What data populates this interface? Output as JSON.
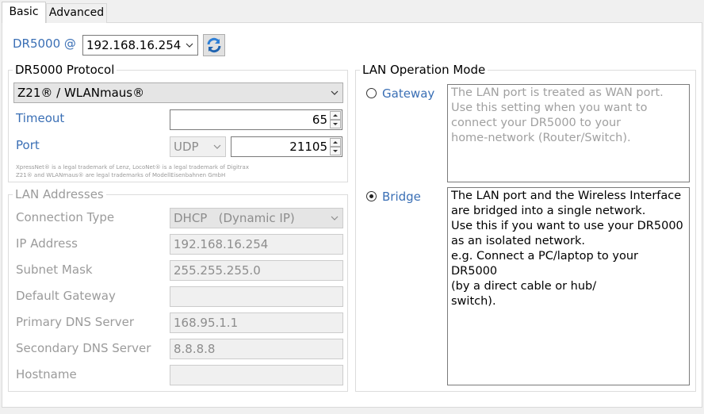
{
  "tabs": [
    {
      "label": "Basic"
    },
    {
      "label": "Advanced"
    }
  ],
  "device": {
    "label": "DR5000 @",
    "selected_ip": "192.168.16.254",
    "refresh_icon": "refresh-icon"
  },
  "protocol": {
    "title": "DR5000 Protocol",
    "selected": "Z21® / WLANmaus®",
    "timeout_label": "Timeout",
    "timeout_value": "65",
    "port_label": "Port",
    "port_type": "UDP",
    "port_value": "21105",
    "trademark_line1": "XpressNet® is a legal trademark of  Lenz, LocoNet® is a legal trademark of Digitrax",
    "trademark_line2": "Z21® and WLANmaus® are legal trademarks of ModellEisenbahnen GmbH"
  },
  "lan": {
    "title": "LAN Addresses",
    "connection_type_label": "Connection Type",
    "connection_type_value": "DHCP   (Dynamic IP)",
    "ip_label": "IP Address",
    "ip_value": "192.168.16.254",
    "subnet_label": "Subnet Mask",
    "subnet_value": "255.255.255.0",
    "gateway_label": "Default Gateway",
    "gateway_value": "",
    "dns1_label": "Primary DNS Server",
    "dns1_value": "168.95.1.1",
    "dns2_label": "Secondary DNS Server",
    "dns2_value": "8.8.8.8",
    "hostname_label": "Hostname",
    "hostname_value": ""
  },
  "mode": {
    "title": "LAN Operation Mode",
    "gateway_label": "Gateway",
    "gateway_desc": "The LAN port is treated as WAN port.\nUse this setting when you want to\nconnect your DR5000 to your\nhome-network (Router/Switch).",
    "bridge_label": "Bridge",
    "bridge_desc": "The LAN port and the Wireless Interface\nare bridged into a single network.\nUse this if you want to use your DR5000\nas an isolated network.\ne.g. Connect a PC/laptop to your DR5000\n(by a direct cable or hub/\nswitch).",
    "selected": "Bridge"
  },
  "colors": {
    "accent_label": "#3a6fb5",
    "disabled_text": "#9b9b9b",
    "refresh_icon": "#2e7fd6"
  }
}
